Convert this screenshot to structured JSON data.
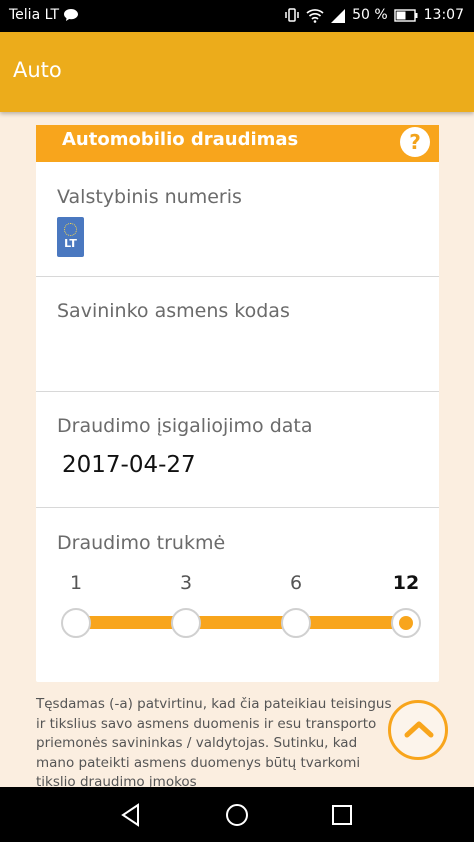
{
  "status_bar": {
    "carrier": "Telia LT",
    "battery": "50 %",
    "time": "13:07"
  },
  "app_bar": {
    "title": "Auto"
  },
  "card": {
    "title": "Automobilio draudimas",
    "help_symbol": "?"
  },
  "fields": {
    "plate_label": "Valstybinis numeris",
    "plate_country": "LT",
    "owner_code_label": "Savininko asmens kodas",
    "start_date_label": "Draudimo įsigaliojimo data",
    "start_date_value": "2017-04-27",
    "duration_label": "Draudimo trukmė"
  },
  "duration_slider": {
    "options": [
      "1",
      "3",
      "6",
      "12"
    ],
    "selected": "12"
  },
  "legal_text": "Tęsdamas (-a) patvirtinu, kad čia pateikiau teisingus ir tikslius savo asmens duomenis ir esu transporto priemonės savininkas / valdytojas. Sutinku, kad mano pateikti asmens duomenys būtų tvarkomi tikslio draudimo įmokos",
  "colors": {
    "accent": "#f8a51c",
    "app_bar": "#ecac1b",
    "background": "#fbeee0"
  },
  "icons": {
    "message": "chat-bubble-icon",
    "vibrate": "vibrate-icon",
    "wifi": "wifi-icon",
    "signal": "signal-icon",
    "battery": "battery-icon",
    "help": "question-icon",
    "scroll_top": "chevron-up-icon",
    "back": "back-triangle-icon",
    "home": "home-circle-icon",
    "recents": "recents-square-icon"
  }
}
